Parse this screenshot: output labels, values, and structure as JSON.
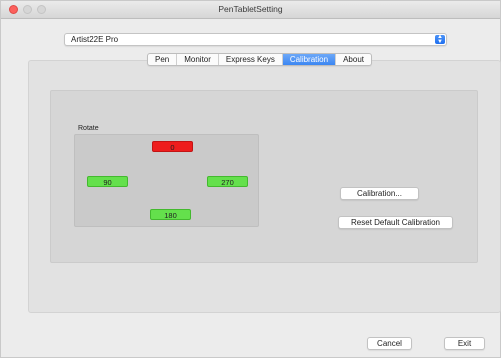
{
  "window": {
    "title": "PenTabletSetting"
  },
  "device": {
    "selected": "Artist22E Pro",
    "arrows": "⌃⌄"
  },
  "tabs": [
    {
      "label": "Pen"
    },
    {
      "label": "Monitor"
    },
    {
      "label": "Express Keys"
    },
    {
      "label": "Calibration",
      "active": true
    },
    {
      "label": "About"
    }
  ],
  "rotate": {
    "label": "Rotate",
    "options": [
      {
        "label": "0",
        "selected": true
      },
      {
        "label": "90",
        "selected": false
      },
      {
        "label": "270",
        "selected": false
      },
      {
        "label": "180",
        "selected": false
      }
    ]
  },
  "buttons": {
    "calibration": "Calibration...",
    "reset": "Reset Default Calibration",
    "cancel": "Cancel",
    "exit": "Exit"
  },
  "colors": {
    "selected_rotation": "#ee1d1d",
    "unselected_rotation": "#64e04c",
    "accent": "#3c86f2"
  }
}
